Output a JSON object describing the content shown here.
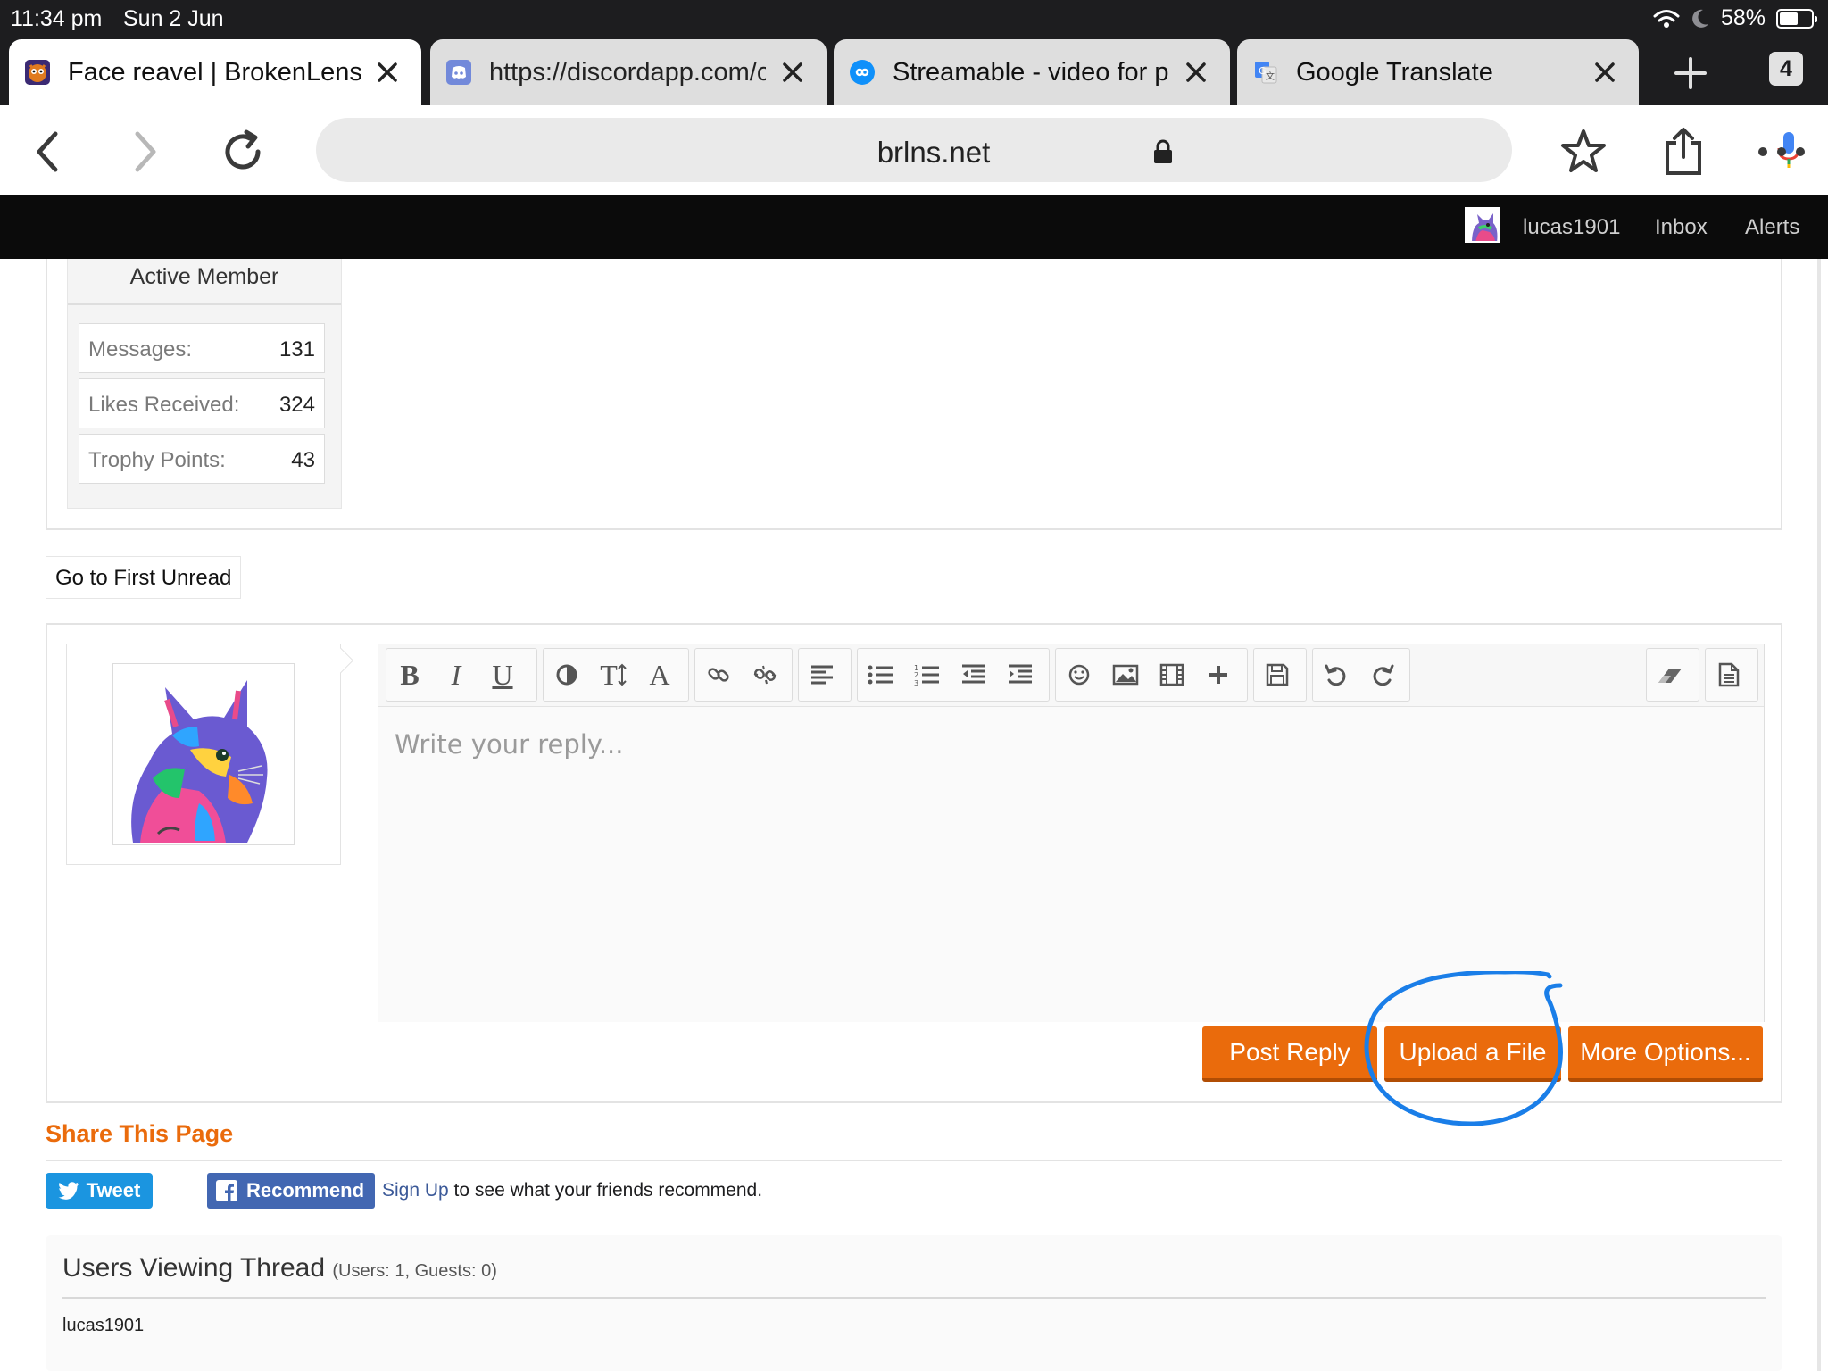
{
  "status_bar": {
    "time": "11:34 pm",
    "date": "Sun 2 Jun",
    "battery": "58%",
    "battery_level_percent": 58
  },
  "tabs": [
    {
      "title": "Face reavel | BrokenLens",
      "favicon": "brokenlens-favicon",
      "active": true
    },
    {
      "title": "https://discordapp.com/c",
      "favicon": "discord-favicon",
      "active": false
    },
    {
      "title": "Streamable - video for pu",
      "favicon": "streamable-favicon",
      "active": false
    },
    {
      "title": "Google Translate",
      "favicon": "google-translate-favicon",
      "active": false
    }
  ],
  "tab_count": "4",
  "toolbar": {
    "url": "brlns.net"
  },
  "forum_bar": {
    "username": "lucas1901",
    "inbox": "Inbox",
    "alerts": "Alerts"
  },
  "post_user": {
    "title": "Active Member",
    "stats": [
      {
        "label": "Messages:",
        "value": "131"
      },
      {
        "label": "Likes Received:",
        "value": "324"
      },
      {
        "label": "Trophy Points:",
        "value": "43"
      }
    ]
  },
  "go_first_unread": "Go to First Unread",
  "reply": {
    "placeholder": "Write your reply...",
    "post_reply": "Post Reply",
    "upload_file": "Upload a File",
    "more_options": "More Options..."
  },
  "editor_tools": {
    "bold": "B",
    "italic": "I",
    "underline": "U",
    "font_size": "T",
    "font_family": "A"
  },
  "share": {
    "title": "Share This Page",
    "tweet": "Tweet",
    "recommend": "Recommend",
    "signup_link": "Sign Up",
    "signup_text": " to see what your friends recommend."
  },
  "viewers": {
    "title": "Users Viewing Thread",
    "subtitle": "(Users: 1, Guests: 0)",
    "names": [
      "lucas1901"
    ]
  },
  "colors": {
    "accent_orange": "#ea6b0c",
    "annotation_blue": "#1a7ee8",
    "twitter_blue": "#1b95e0",
    "facebook_blue": "#4267b2"
  }
}
